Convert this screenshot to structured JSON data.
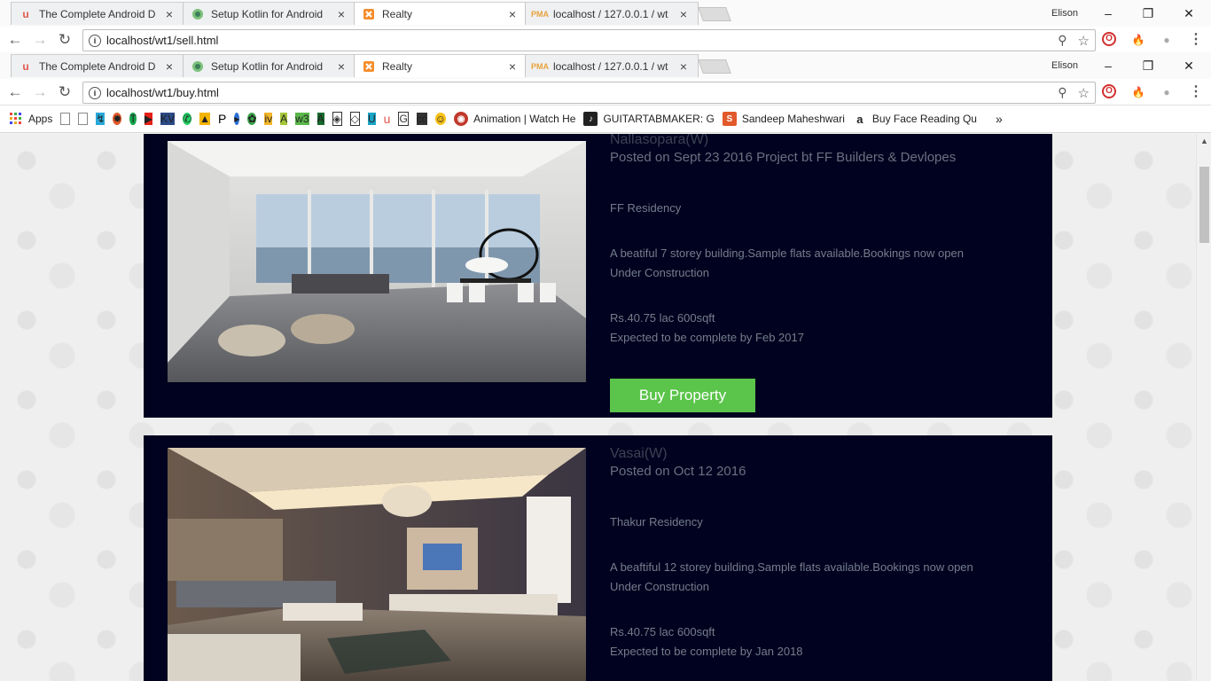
{
  "window1": {
    "tabs": [
      {
        "title": "The Complete Android D",
        "icon": "udemy-icon"
      },
      {
        "title": "Setup Kotlin for Android",
        "icon": "android-studio-icon"
      },
      {
        "title": "Realty",
        "icon": "xampp-icon",
        "active": true
      },
      {
        "title": "localhost / 127.0.0.1 / wt",
        "icon": "phpmyadmin-icon"
      }
    ],
    "profile": "Elison",
    "url": "localhost/wt1/sell.html"
  },
  "window2": {
    "tabs": [
      {
        "title": "The Complete Android D",
        "icon": "udemy-icon"
      },
      {
        "title": "Setup Kotlin for Android",
        "icon": "android-studio-icon"
      },
      {
        "title": "Realty",
        "icon": "xampp-icon",
        "active": true
      },
      {
        "title": "localhost / 127.0.0.1 / wt",
        "icon": "phpmyadmin-icon"
      }
    ],
    "profile": "Elison",
    "url": "localhost/wt1/buy.html"
  },
  "bookmarks": {
    "apps_label": "Apps",
    "labeled": [
      {
        "label": "Animation | Watch He",
        "icon": "animation-icon"
      },
      {
        "label": "GUITARTABMAKER: G",
        "icon": "guitartabmaker-icon"
      },
      {
        "label": "Sandeep Maheshwari",
        "icon": "sandeep-icon"
      },
      {
        "label": "Buy Face Reading Qu",
        "icon": "amazon-icon"
      }
    ],
    "more": "»"
  },
  "listings": [
    {
      "location": "Nallasopara(W)",
      "posted": "Posted on Sept 23 2016 Project bt FF Builders & Devlopes",
      "name": "FF Residency",
      "description": "A beatiful 7 storey building.Sample flats available.Bookings now open",
      "status": "Under Construction",
      "price": "Rs.40.75 lac 600sqft",
      "completion": "Expected to be complete by Feb 2017",
      "button": "Buy Property"
    },
    {
      "location": "Vasai(W)",
      "posted": "Posted on Oct 12 2016",
      "name": "Thakur Residency",
      "description": "A beaftiful 12 storey building.Sample flats available.Bookings now open",
      "status": "Under Construction",
      "price": "Rs.40.75 lac 600sqft",
      "completion": "Expected to be complete by Jan 2018"
    }
  ],
  "colors": {
    "listing_bg": "#00021f",
    "buy_button": "#5bc44a"
  }
}
